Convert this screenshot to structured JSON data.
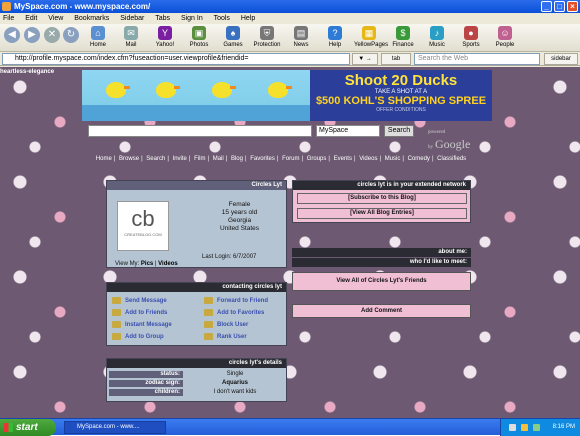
{
  "window": {
    "title": "MySpace.com - www.myspace.com/"
  },
  "menu": [
    "File",
    "Edit",
    "View",
    "Bookmarks",
    "Sidebar",
    "Tabs",
    "Sign In",
    "Tools",
    "Help"
  ],
  "toolbar": {
    "items": [
      "Home",
      "Mail",
      "Yahoo!",
      "Photos",
      "Games",
      "Protection",
      "News",
      "Help",
      "YellowPages",
      "Finance",
      "Music",
      "Sports",
      "People"
    ]
  },
  "address": {
    "url": "http://profile.myspace.com/index.cfm?fuseaction=user.viewprofile&friendid=",
    "tab_label": "tab",
    "search_placeholder": "Search the Web",
    "sidebar_label": "sidebar"
  },
  "page": {
    "tag": "heartless-elegance",
    "banner": {
      "line1": "Shoot 20 Ducks",
      "line2": "TAKE A SHOT AT A",
      "line3": "$500 KOHL'S SHOPPING SPREE",
      "line4": "OFFER CONDITIONS"
    },
    "search": {
      "select_value": "MySpace",
      "button": "Search",
      "powered": "powered by",
      "google": "Google"
    },
    "nav_links": [
      "Home",
      "Browse",
      "Search",
      "Invite",
      "Film",
      "Mail",
      "Blog",
      "Favorites",
      "Forum",
      "Groups",
      "Events",
      "Videos",
      "Music",
      "Comedy",
      "Classifieds"
    ],
    "profile": {
      "header": "Circles Lyt",
      "logo_main": "cb",
      "logo_text": "CREATEBLOG.COM",
      "gender": "Female",
      "age": "15 years old",
      "state": "Georgia",
      "country": "United States",
      "last_login": "Last Login: 6/7/2007",
      "view_my": "View My:",
      "pics": "Pics",
      "videos": "Videos"
    },
    "contacting": {
      "header": "contacting circles lyt",
      "items": [
        "Send Message",
        "Forward to Friend",
        "Add to Friends",
        "Add to Favorites",
        "Instant Message",
        "Block User",
        "Add to Group",
        "Rank User"
      ]
    },
    "details": {
      "header": "circles lyt's details",
      "rows": [
        {
          "label": "status:",
          "value": "Single"
        },
        {
          "label": "zodiac sign:",
          "value": "Aquarius"
        },
        {
          "label": "children:",
          "value": "I don't want kids"
        }
      ]
    },
    "extended": {
      "header": "circles lyt is in your extended network",
      "subscribe": "[Subscribe to this Blog]",
      "view_blog": "[View All Blog Entries]"
    },
    "about": {
      "about_me": "about me:",
      "who_meet": "who I'd like to meet:"
    },
    "friends_link": "View All of Circles Lyt's Friends",
    "comment_link": "Add Comment"
  },
  "taskbar": {
    "start": "start",
    "task": "MySpace.com - www....",
    "clock": "8:16 PM"
  },
  "colors": {
    "background": "#6d5a72",
    "panel": "#b5c4d2",
    "pink": "#f0bfd4",
    "link": "#3a4fb0"
  }
}
